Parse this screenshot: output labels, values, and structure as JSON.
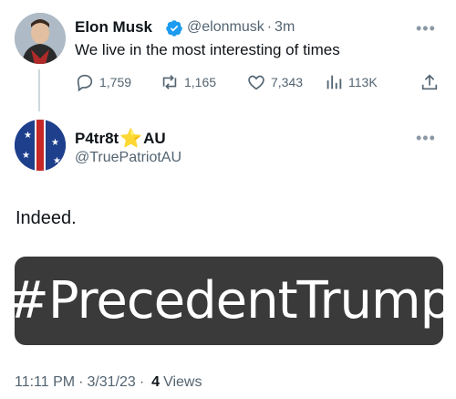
{
  "parent_tweet": {
    "name": "Elon Musk",
    "handle": "@elonmusk",
    "separator": "·",
    "time": "3m",
    "text": "We live in the most interesting of times",
    "replies": "1,759",
    "retweets": "1,165",
    "likes": "7,343",
    "views": "113K",
    "avatar_icon": "profile-photo",
    "verified_icon": "verified-badge-icon"
  },
  "reply_tweet": {
    "name_prefix": "P4tr8t",
    "name_suffix": "AU",
    "name_emoji": "⭐",
    "handle": "@TruePatriotAU",
    "text": "Indeed.",
    "image_text": "#PrecedentTrump"
  },
  "meta": {
    "time": "11:11 PM",
    "date": "3/31/23",
    "views_count": "4",
    "views_label": "Views",
    "separator": "·"
  },
  "colors": {
    "text": "#0f1419",
    "secondary": "#536471",
    "verified": "#1d9bf0",
    "image_bg": "#3a3a3a"
  }
}
